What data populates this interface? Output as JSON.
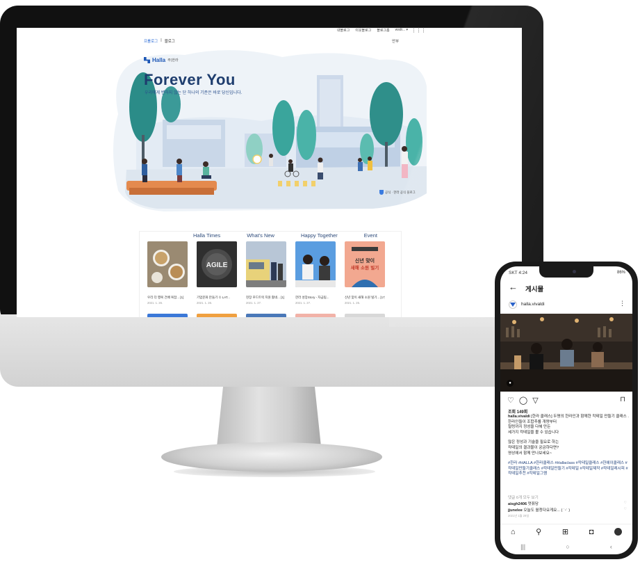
{
  "blog": {
    "top_links": [
      "내블로그",
      "이웃블로그",
      "블로그홈",
      "wsdr... ▾"
    ],
    "tabs": {
      "home": "프롤로그",
      "sep": "|",
      "blog": "블로그"
    },
    "lang": "안부",
    "hero": {
      "logo_word": "Halla",
      "logo_sub": "주)한라",
      "title": "Forever You",
      "subtitle": "우리에게 변하지 않는 단 하나의 기준은 바로 당신입니다.",
      "badge": "공식 · 한라 공식 블로그"
    },
    "nav": [
      "Halla Times",
      "What's New",
      "Happy Together",
      "Event"
    ],
    "posts": [
      {
        "title": "우리 더 행복 건배 복잡... [1]",
        "date": "2021. 1. 26."
      },
      {
        "title": "기업문화 만들기 ① LAT...",
        "date": "2021. 1. 26."
      },
      {
        "title": "현장 푸드트럭 지원 활네... [1]",
        "date": "2021. 1. 27."
      },
      {
        "title": "한라 성장Story - 자금팀...",
        "date": "2021. 1. 27."
      },
      {
        "title": "신년 맞이 새해 소원 빌기... [17]",
        "date": "2021. 1. 25."
      }
    ],
    "post_thumb_text": {
      "agile": "AGILE",
      "newyear_l1": "신년 맞이",
      "newyear_l2": "새해 소원 빌기"
    }
  },
  "phone": {
    "status_left": "SKT 4:24",
    "status_right": "86%",
    "header": "게시물",
    "username": "halla.vivaldi",
    "views": "조회 149회",
    "caption": [
      {
        "bold": "halla.vivaldi",
        "text": " [한라 클래스] 두명의 한라인과 함께한 칵테일 만들기 클래스 ."
      },
      {
        "text": "한라인들이 조합추룹 개량부터"
      },
      {
        "text": "철렁까지 정성을 다해 만든"
      },
      {
        "text": "세가지 칵테일을 볼 수 있습니다"
      }
    ],
    "caption2": [
      "많은 정성과 기술을 필요로 하는",
      "칵테일의 결과물이 궁금하다면?",
      "영상에서 함께 만나보세요~"
    ],
    "hashtags": "#한라 #HALLA #한라클래스 #Hallaclass #칵테일클래스 #한에이클래스 #칵테일만들기클래스 #칵테일만들기 #칵테일 #칵테일제작 #칵테일레시피 #칵테일추천 #칵테일그램",
    "comments_link": "댓글 6개 모두 보기",
    "comment1": {
      "user": "aisgh2406",
      "text": " 멋쮸당"
    },
    "comment2": {
      "user": "jjunelee",
      "text": " 오늘도 월청다요게요... ( ˙ᵕ˙ )"
    },
    "date": "2021년 1월 29일"
  },
  "colors": {
    "accent": "#1d57b6",
    "hero_title": "#1e3d6e",
    "hashtag": "#1e3f7a"
  }
}
